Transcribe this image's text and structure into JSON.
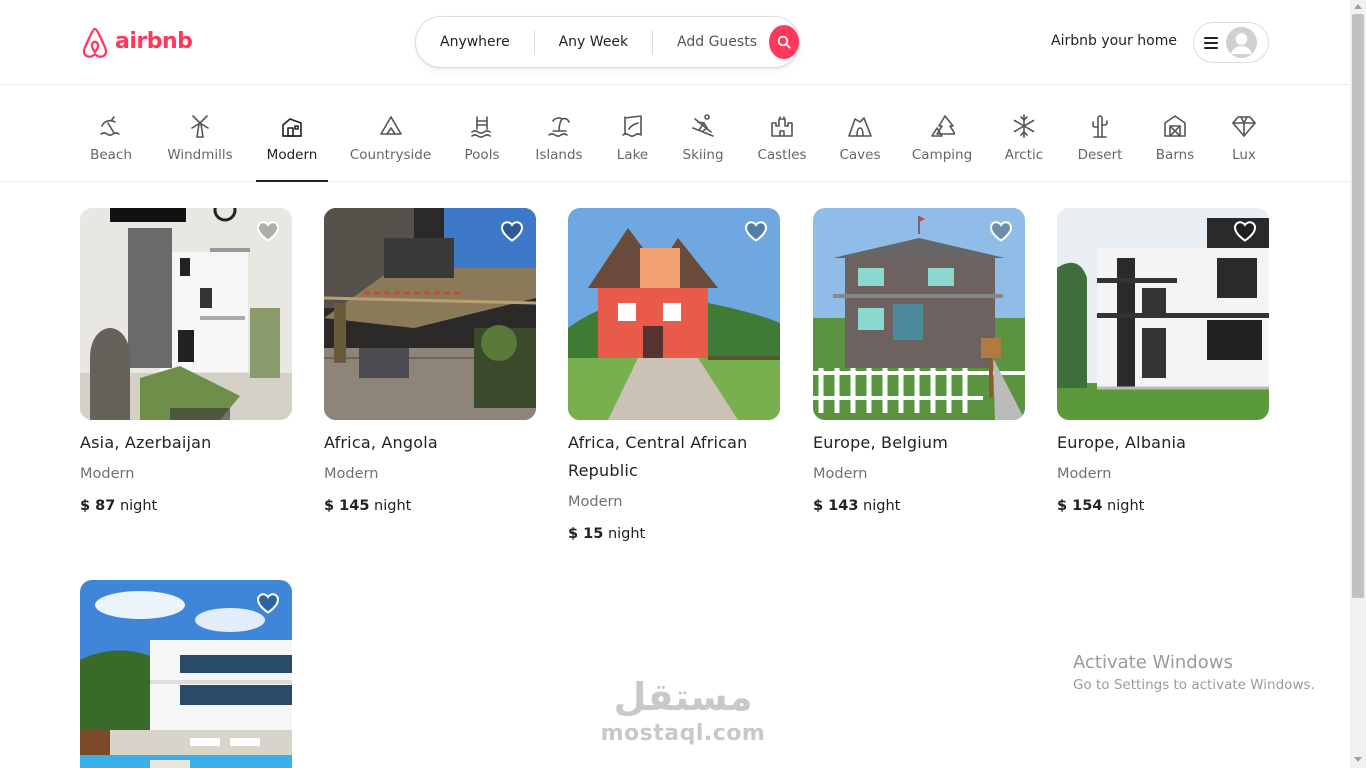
{
  "brand": {
    "name": "airbnb",
    "color": "#ff385c"
  },
  "search": {
    "where": "Anywhere",
    "when": "Any Week",
    "guests": "Add Guests",
    "button_icon": "search-icon"
  },
  "header": {
    "host_link": "Airbnb your home",
    "menu_icon": "hamburger-icon",
    "avatar_icon": "user-avatar-icon"
  },
  "categories": [
    {
      "label": "Beach",
      "icon": "beach-icon",
      "active": false
    },
    {
      "label": "Windmills",
      "icon": "windmill-icon",
      "active": false
    },
    {
      "label": "Modern",
      "icon": "modern-house-icon",
      "active": true
    },
    {
      "label": "Countryside",
      "icon": "mountain-icon",
      "active": false
    },
    {
      "label": "Pools",
      "icon": "pool-icon",
      "active": false
    },
    {
      "label": "Islands",
      "icon": "island-icon",
      "active": false
    },
    {
      "label": "Lake",
      "icon": "lake-icon",
      "active": false
    },
    {
      "label": "Skiing",
      "icon": "skiing-icon",
      "active": false
    },
    {
      "label": "Castles",
      "icon": "castle-icon",
      "active": false
    },
    {
      "label": "Caves",
      "icon": "cave-icon",
      "active": false
    },
    {
      "label": "Camping",
      "icon": "camping-icon",
      "active": false
    },
    {
      "label": "Arctic",
      "icon": "snowflake-icon",
      "active": false
    },
    {
      "label": "Desert",
      "icon": "cactus-icon",
      "active": false
    },
    {
      "label": "Barns",
      "icon": "barn-icon",
      "active": false
    },
    {
      "label": "Lux",
      "icon": "diamond-icon",
      "active": false
    }
  ],
  "listings": [
    {
      "title": "Asia, Azerbaijan",
      "type": "Modern",
      "price": "$ 87",
      "unit": "night"
    },
    {
      "title": "Africa, Angola",
      "type": "Modern",
      "price": "$ 145",
      "unit": "night"
    },
    {
      "title": "Africa, Central African Republic",
      "type": "Modern",
      "price": "$ 15",
      "unit": "night"
    },
    {
      "title": "Europe, Belgium",
      "type": "Modern",
      "price": "$ 143",
      "unit": "night"
    },
    {
      "title": "Europe, Albania",
      "type": "Modern",
      "price": "$ 154",
      "unit": "night"
    },
    {
      "title": "",
      "type": "",
      "price": "",
      "unit": ""
    }
  ],
  "watermarks": {
    "activate_title": "Activate Windows",
    "activate_sub": "Go to Settings to activate Windows.",
    "mostaql_ar": "مستقل",
    "mostaql_lat": "mostaql.com"
  }
}
